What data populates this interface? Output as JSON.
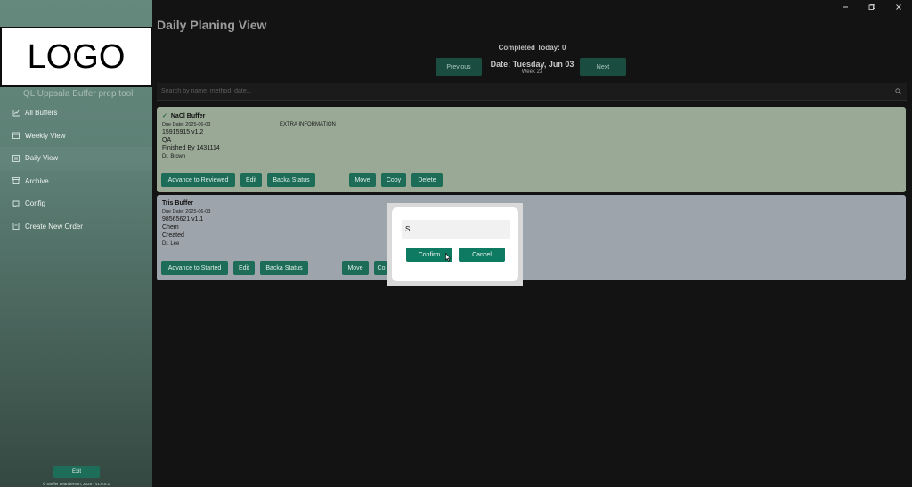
{
  "sidebar": {
    "logo_text": "LOGO",
    "app_name": "QL Uppsala Buffer prep tool",
    "items": [
      {
        "label": "All Buffers",
        "icon": "chart-icon"
      },
      {
        "label": "Weekly View",
        "icon": "calendar-icon"
      },
      {
        "label": "Daily View",
        "icon": "daily-icon"
      },
      {
        "label": "Archive",
        "icon": "archive-icon"
      },
      {
        "label": "Config",
        "icon": "config-icon"
      },
      {
        "label": "Create New Order",
        "icon": "order-icon"
      }
    ],
    "exit_label": "Exit",
    "footer": "© Steffer Leanderson, 2025 - v1.0.0.1"
  },
  "header": {
    "title": "Daily Planing View",
    "completed": "Completed Today: 0",
    "previous_label": "Previous",
    "next_label": "Next",
    "date": "Date: Tuesday, Jun 03",
    "week": "Week 23"
  },
  "search": {
    "placeholder": "Search by name, method, date..."
  },
  "cards": [
    {
      "title": "NaCl Buffer",
      "due": "Due Date: 2025-06-03",
      "code": "15915915 v1.2",
      "dept": "QA",
      "status": "Finished By 1431114",
      "owner": "Dr. Brown",
      "extra": "EXTRA INFORMATION",
      "actions": [
        "Advance to Reviewed",
        "Edit",
        "Backa Status",
        "Move",
        "Copy",
        "Delete"
      ]
    },
    {
      "title": "Tris Buffer",
      "due": "Due Date: 2025-06-03",
      "code": "98565621 v1.1",
      "dept": "Chem",
      "status": "Created",
      "owner": "Dr. Lee",
      "actions": [
        "Advance to Started",
        "Edit",
        "Backa Status",
        "Move",
        "Co"
      ]
    }
  ],
  "dialog": {
    "input_value": "SL",
    "confirm_label": "Confirm",
    "cancel_label": "Cancel"
  },
  "colors": {
    "accent": "#1c6c57",
    "sidebar": "#65897d",
    "background": "#131313"
  }
}
